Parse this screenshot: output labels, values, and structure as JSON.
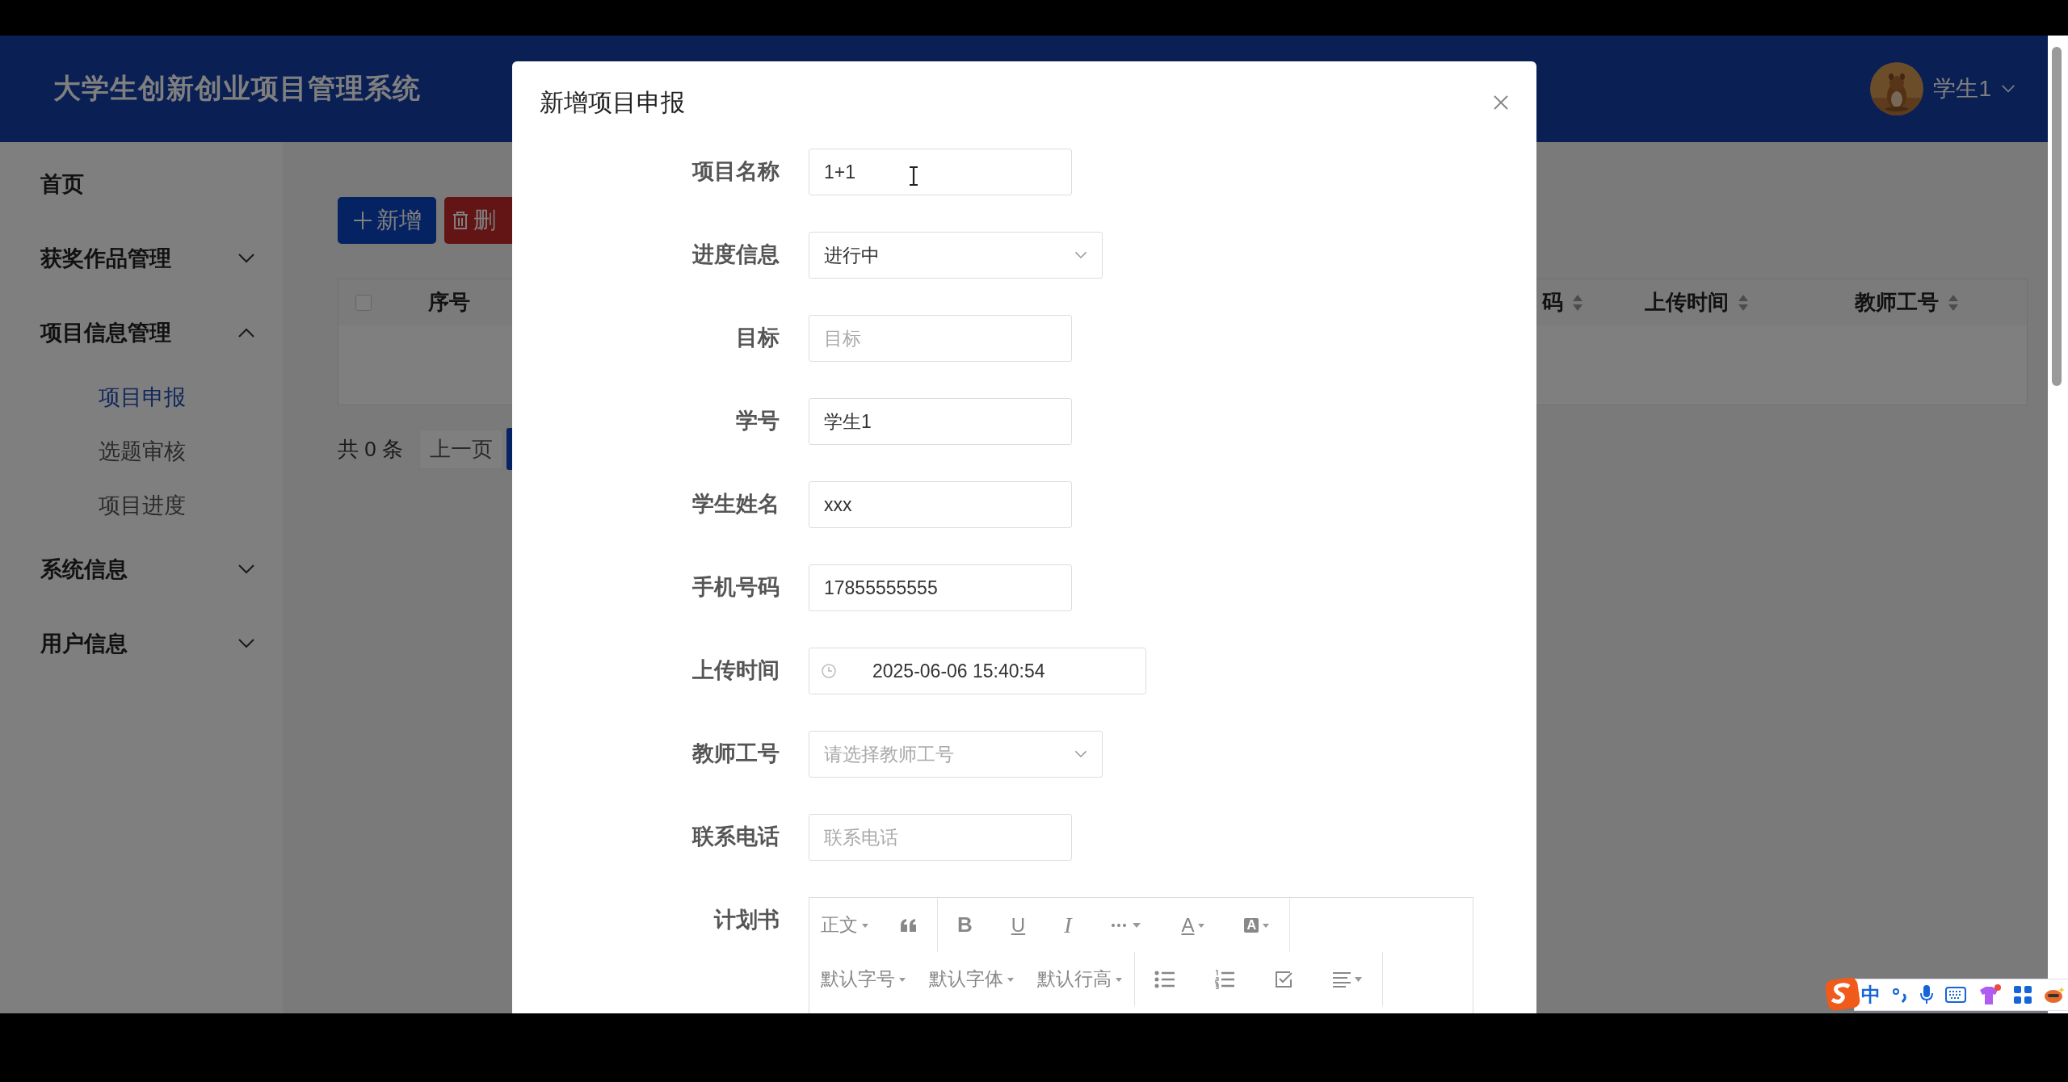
{
  "header": {
    "title": "大学生创新创业项目管理系统",
    "user": {
      "name": "学生1"
    }
  },
  "sidebar": {
    "items": [
      {
        "label": "首页"
      },
      {
        "label": "获奖作品管理",
        "expanded": false
      },
      {
        "label": "项目信息管理",
        "expanded": true,
        "children": [
          {
            "label": "项目申报",
            "selected": true
          },
          {
            "label": "选题审核",
            "selected": false
          },
          {
            "label": "项目进度",
            "selected": false
          }
        ]
      },
      {
        "label": "系统信息",
        "expanded": false
      },
      {
        "label": "用户信息",
        "expanded": false
      }
    ]
  },
  "toolbar": {
    "buttons": [
      {
        "kind": "add",
        "label": "新增"
      },
      {
        "kind": "delete",
        "label": "删"
      }
    ]
  },
  "table": {
    "select_all": {
      "checked": false
    },
    "columns": [
      {
        "label": "序号",
        "sortable": false
      },
      {
        "label": "码",
        "sortable": true
      },
      {
        "label": "上传时间",
        "sortable": true
      },
      {
        "label": "教师工号",
        "sortable": true
      }
    ]
  },
  "pagination": {
    "total": "共 0 条",
    "prev": "上一页"
  },
  "dialog": {
    "title": "新增项目申报",
    "fields": [
      {
        "kind": "input",
        "label": "项目名称",
        "value": "1+1"
      },
      {
        "kind": "select",
        "label": "进度信息",
        "value": "进行中"
      },
      {
        "kind": "input",
        "label": "目标",
        "placeholder": "目标"
      },
      {
        "kind": "input",
        "label": "学号",
        "value": "学生1"
      },
      {
        "kind": "input",
        "label": "学生姓名",
        "value": "xxx"
      },
      {
        "kind": "input",
        "label": "手机号码",
        "value": "17855555555"
      },
      {
        "kind": "date",
        "label": "上传时间",
        "value": "2025-06-06 15:40:54"
      },
      {
        "kind": "select",
        "label": "教师工号",
        "placeholder": "请选择教师工号"
      },
      {
        "kind": "input",
        "label": "联系电话",
        "placeholder": "联系电话"
      },
      {
        "kind": "editor",
        "label": "计划书",
        "toolbar": [
          [
            {
              "kind": "dropdown",
              "label": "正文"
            },
            {
              "kind": "quote"
            },
            {
              "kind": "bold",
              "label": "B"
            },
            {
              "kind": "underline",
              "label": "U"
            },
            {
              "kind": "italic",
              "label": "I"
            },
            {
              "kind": "more"
            },
            {
              "kind": "font-color",
              "label": "A"
            },
            {
              "kind": "bg-color",
              "label": "A"
            }
          ],
          [
            {
              "kind": "dropdown",
              "label": "默认字号"
            },
            {
              "kind": "dropdown",
              "label": "默认字体"
            },
            {
              "kind": "dropdown",
              "label": "默认行高"
            },
            {
              "kind": "bullet-list"
            },
            {
              "kind": "numbered-list"
            },
            {
              "kind": "todo"
            },
            {
              "kind": "align"
            }
          ]
        ]
      }
    ]
  },
  "ime": {
    "mode": "中"
  }
}
